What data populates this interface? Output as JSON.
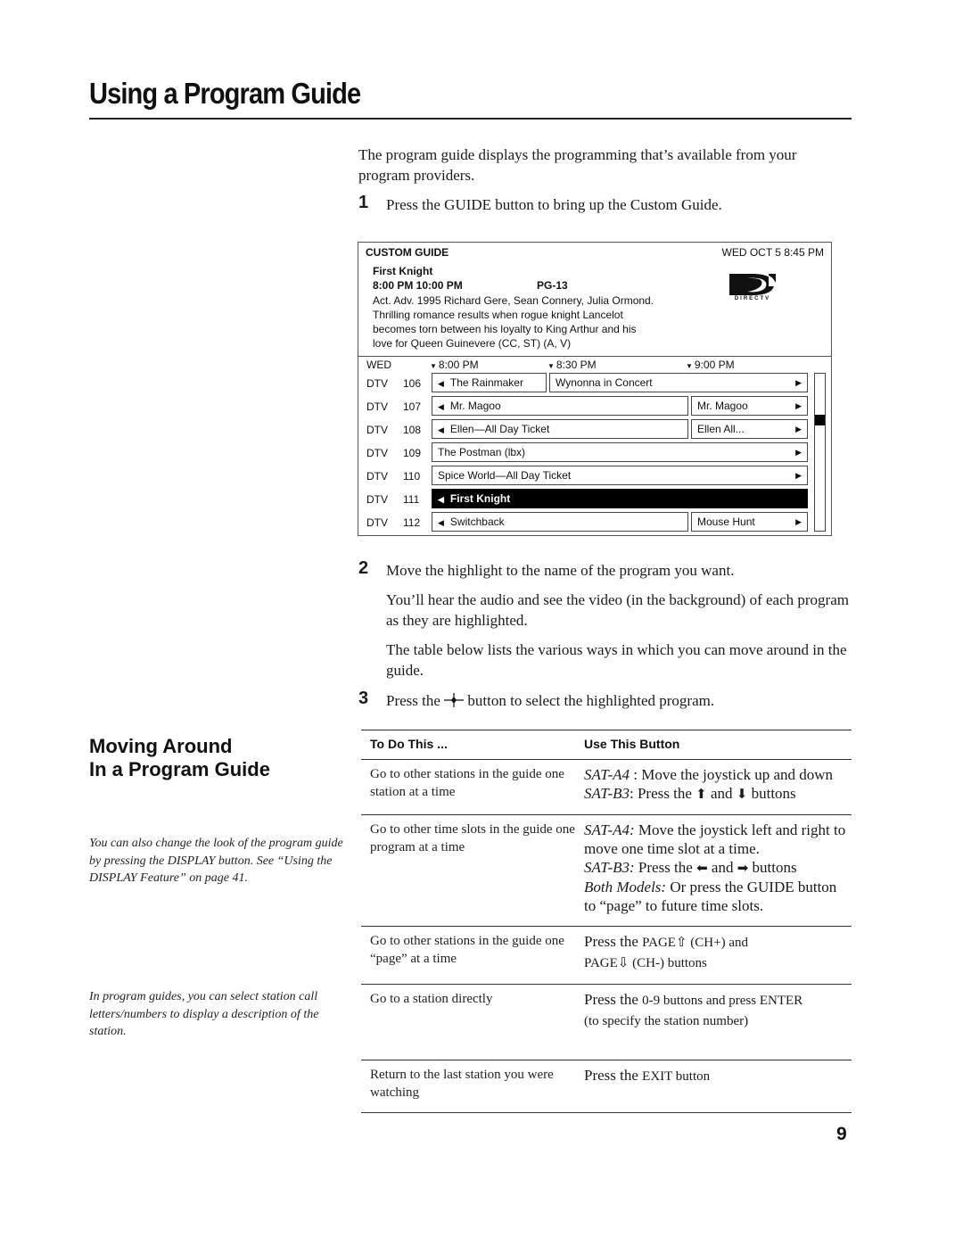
{
  "page": {
    "title": "Using a Program Guide",
    "intro": "The program guide displays the programming that’s available from your program providers.",
    "page_number": "9"
  },
  "steps": [
    {
      "num": "1",
      "text": "Press the GUIDE button to bring up the Custom Guide."
    },
    {
      "num": "2",
      "text": "Move the highlight to the name of the program you want.",
      "subparas": [
        "You’ll hear the audio and see the video (in the background) of each program as they are highlighted.",
        "The table below lists the various ways in which you can move around in the guide."
      ]
    },
    {
      "num": "3",
      "text_before": "Press the",
      "icon": "select-crosshair-icon",
      "icon_glyph": "—•—",
      "text_after": "button to select the highlighted program."
    }
  ],
  "guide": {
    "label": "CUSTOM GUIDE",
    "datetime": "WED OCT 5 8:45 PM",
    "selected_program": {
      "title": "First Knight",
      "times": "8:00 PM 10:00 PM",
      "rating": "PG-13",
      "description": "Act. Adv. 1995 Richard Gere, Sean Connery, Julia Ormond. Thrilling romance results when rogue knight Lancelot becomes torn between his loyalty to King Arthur and his love for Queen Guinevere (CC, ST) (A, V)"
    },
    "logo_text": "DIRECTV",
    "day": "WED",
    "time_slots": [
      "8:00 PM",
      "8:30 PM",
      "9:00 PM"
    ],
    "channels": [
      {
        "call": "DTV",
        "num": "106",
        "programs": [
          {
            "title": "The Rainmaker",
            "left_arrow": true,
            "right_arrow": false
          },
          {
            "title": "Wynonna in Concert",
            "left_arrow": false,
            "right_arrow": true
          }
        ]
      },
      {
        "call": "DTV",
        "num": "107",
        "programs": [
          {
            "title": "Mr. Magoo",
            "left_arrow": true,
            "right_arrow": false
          },
          {
            "title": "Mr. Magoo",
            "left_arrow": false,
            "right_arrow": true
          }
        ]
      },
      {
        "call": "DTV",
        "num": "108",
        "programs": [
          {
            "title": "Ellen—All Day Ticket",
            "left_arrow": true,
            "right_arrow": false
          },
          {
            "title": "Ellen All...",
            "left_arrow": false,
            "right_arrow": true
          }
        ]
      },
      {
        "call": "DTV",
        "num": "109",
        "programs": [
          {
            "title": "The Postman (lbx)",
            "left_arrow": false,
            "right_arrow": true
          }
        ]
      },
      {
        "call": "DTV",
        "num": "110",
        "programs": [
          {
            "title": "Spice World—All Day Ticket",
            "left_arrow": false,
            "right_arrow": true
          }
        ]
      },
      {
        "call": "DTV",
        "num": "111",
        "programs": [
          {
            "title": "First Knight",
            "left_arrow": true,
            "right_arrow": false,
            "selected": true
          }
        ]
      },
      {
        "call": "DTV",
        "num": "112",
        "programs": [
          {
            "title": "Switchback",
            "left_arrow": true,
            "right_arrow": false
          },
          {
            "title": "Mouse Hunt",
            "left_arrow": false,
            "right_arrow": true
          }
        ]
      }
    ],
    "scroll_position_fraction": 0.28
  },
  "sidebar": {
    "heading_line1": "Moving Around",
    "heading_line2": "In a Program Guide",
    "notes": [
      "You can also change the look of the program guide by pressing the DISPLAY button. See “Using the DISPLAY Feature” on page 41.",
      "In program guides, you can select station call letters/numbers to display a description of the station."
    ]
  },
  "nav_table": {
    "headers": [
      "To Do This ...",
      "Use This Button"
    ],
    "rows": [
      {
        "action": "Go to other stations in the guide one station at a time",
        "lines": [
          {
            "label": "SAT-A4",
            "text": " : Move the joystick up and down"
          },
          {
            "label": "SAT-B3",
            "text_before": ": Press the ",
            "icon1": "⬆",
            "icon1_name": "up-arrow-icon",
            "mid": " and ",
            "icon2": "⬇",
            "icon2_name": "down-arrow-icon",
            "text_after": " buttons"
          }
        ]
      },
      {
        "action": "Go to other time slots in the guide one program at a time",
        "lines": [
          {
            "label": "SAT-A4:",
            "text": " Move the joystick left and right to move one time slot at a time."
          },
          {
            "label": "SAT-B3:",
            "text_before": " Press the ",
            "icon1": "⬅",
            "icon1_name": "left-arrow-icon",
            "mid": "  and ",
            "icon2": "➡",
            "icon2_name": "right-arrow-icon",
            "text_after": " buttons"
          },
          {
            "label": "Both Models:",
            "text": " Or press the GUIDE button to “page” to future time slots."
          }
        ]
      },
      {
        "action": "Go to other stations in the guide one “page” at a time",
        "line1_before": "Press the ",
        "line1_small": "PAGE",
        "page_up_icon": "⇧",
        "line1_after": " (CH+) and",
        "line2_small": "PAGE",
        "page_down_icon": "⇩",
        "line2_after": " (CH-) buttons"
      },
      {
        "action": "Go to a station directly",
        "line1_before": "Press the ",
        "line1_small": "0-9 buttons and press ENTER",
        "line2_small": "(to specify the station number)"
      },
      {
        "action": "Return to the last station you were watching",
        "line1_before": "Press the ",
        "line1_small": "EXIT button"
      }
    ]
  }
}
